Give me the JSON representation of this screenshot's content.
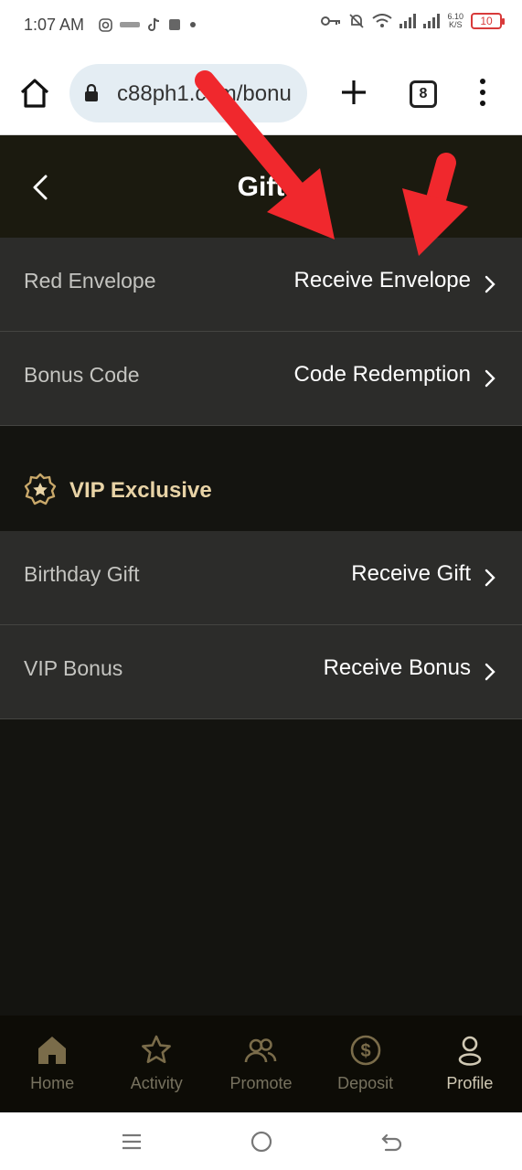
{
  "status_bar": {
    "time": "1:07 AM",
    "apps": [
      "instagram-icon",
      "ucash-icon",
      "tiktok-icon",
      "app-icon",
      "dot-icon"
    ],
    "speed_top": "6.10",
    "speed_bottom": "K/S",
    "battery": "10",
    "battery_color": "#d83a3a"
  },
  "browser": {
    "url": "c88ph1.com/bonu",
    "tab_count": "8"
  },
  "header": {
    "title": "Gift"
  },
  "rows": [
    {
      "label": "Red Envelope",
      "action": "Receive Envelope"
    },
    {
      "label": "Bonus Code",
      "action": "Code Redemption"
    }
  ],
  "vip": {
    "title": "VIP Exclusive",
    "accent": "#e8d3a6"
  },
  "vip_rows": [
    {
      "label": "Birthday Gift",
      "action": "Receive Gift"
    },
    {
      "label": "VIP Bonus",
      "action": "Receive Bonus"
    }
  ],
  "bottom_nav": [
    {
      "label": "Home",
      "icon": "home-icon"
    },
    {
      "label": "Activity",
      "icon": "star-icon"
    },
    {
      "label": "Promote",
      "icon": "users-icon"
    },
    {
      "label": "Deposit",
      "icon": "dollar-icon"
    },
    {
      "label": "Profile",
      "icon": "person-icon"
    }
  ],
  "colors": {
    "header_bg": "#1b1a0f",
    "row_bg": "#2c2c2a",
    "nav_bg": "#0d0c06",
    "arrow": "#f0282d",
    "gold": "#c9a86a"
  }
}
